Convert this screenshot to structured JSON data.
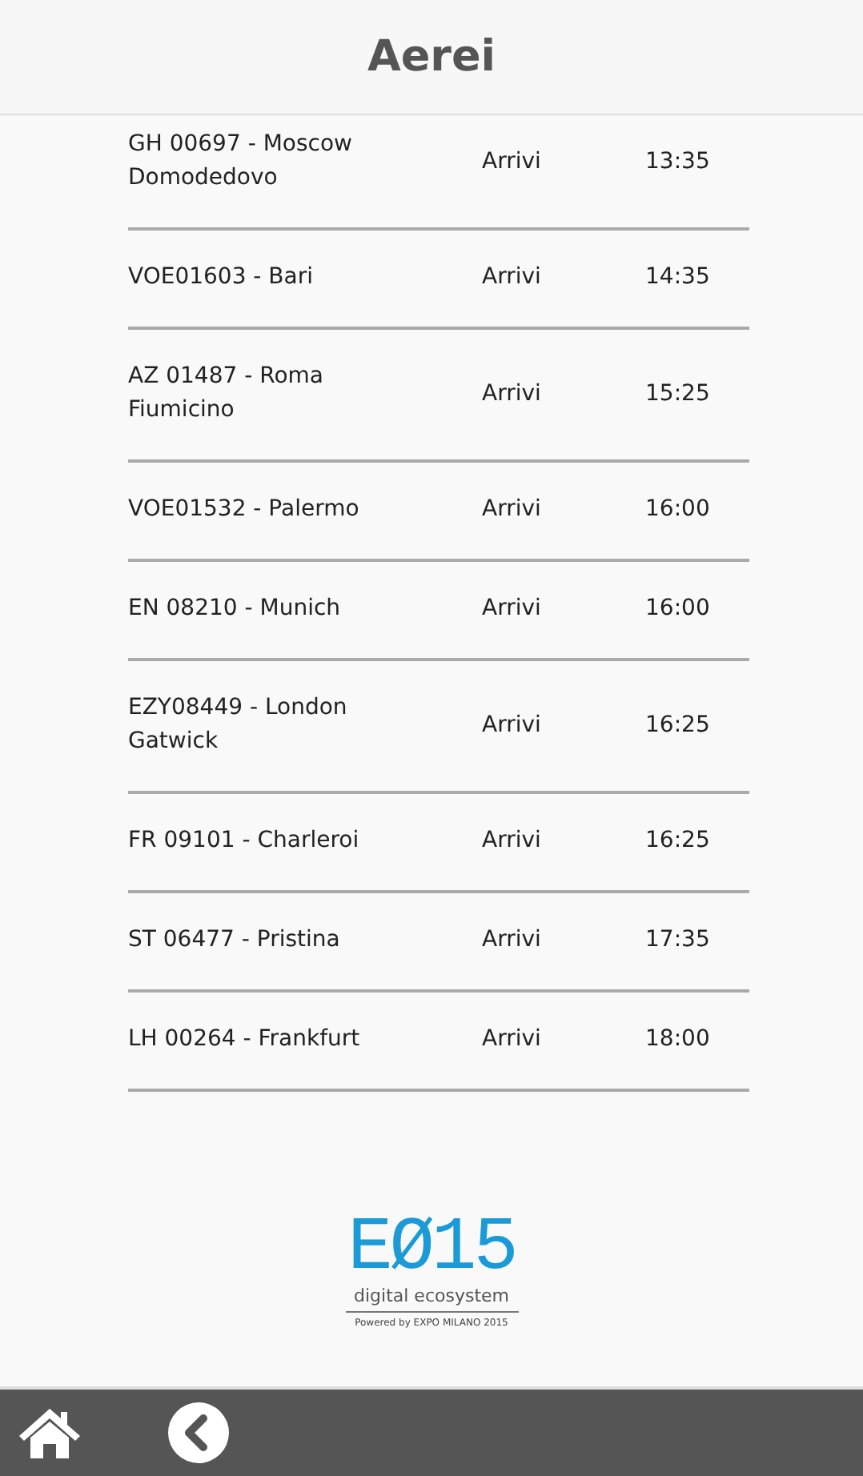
{
  "header": {
    "title": "Aerei"
  },
  "flights": [
    {
      "flight": "GH 00697 - Moscow Domodedovo",
      "direction": "Arrivi",
      "time": "13:35"
    },
    {
      "flight": "VOE01603 - Bari",
      "direction": "Arrivi",
      "time": "14:35"
    },
    {
      "flight": "AZ 01487 - Roma Fiumicino",
      "direction": "Arrivi",
      "time": "15:25"
    },
    {
      "flight": "VOE01532 - Palermo",
      "direction": "Arrivi",
      "time": "16:00"
    },
    {
      "flight": "EN 08210 - Munich",
      "direction": "Arrivi",
      "time": "16:00"
    },
    {
      "flight": "EZY08449 - London Gatwick",
      "direction": "Arrivi",
      "time": "16:25"
    },
    {
      "flight": "FR 09101 - Charleroi",
      "direction": "Arrivi",
      "time": "16:25"
    },
    {
      "flight": "ST 06477 - Pristina",
      "direction": "Arrivi",
      "time": "17:35"
    },
    {
      "flight": "LH 00264 - Frankfurt",
      "direction": "Arrivi",
      "time": "18:00"
    }
  ],
  "logo": {
    "mark": "EØ15",
    "subtitle": "digital ecosystem",
    "powered": "Powered by EXPO MILANO 2015"
  }
}
